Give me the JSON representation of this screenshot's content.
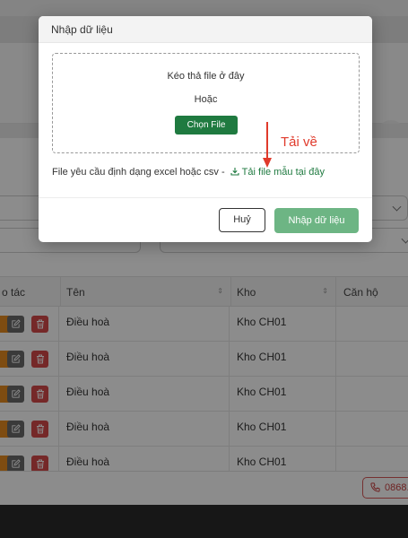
{
  "modal": {
    "title": "Nhập dữ liệu",
    "dropzone_text": "Kéo thả file ở đây",
    "or_text": "Hoặc",
    "choose_button": "Chọn File",
    "requirement_text": "File yêu cầu định dạng excel hoặc csv -",
    "download_link": "Tải file mẫu tại đây",
    "cancel_button": "Huỷ",
    "import_button": "Nhập dữ liệu"
  },
  "annotation": {
    "text": "Tải về",
    "color": "#e03a2b"
  },
  "table": {
    "columns": [
      "o tác",
      "Tên",
      "Kho",
      "Căn hộ"
    ],
    "rows": [
      {
        "name": "Điều hoà",
        "warehouse": "Kho CH01",
        "apartment": ""
      },
      {
        "name": "Điều hoà",
        "warehouse": "Kho CH01",
        "apartment": ""
      },
      {
        "name": "Điều hoà",
        "warehouse": "Kho CH01",
        "apartment": ""
      },
      {
        "name": "Điều hoà",
        "warehouse": "Kho CH01",
        "apartment": ""
      },
      {
        "name": "Điều hoà",
        "warehouse": "Kho CH01",
        "apartment": ""
      }
    ]
  },
  "footer": {
    "phone_label": "0868."
  },
  "colors": {
    "primary_green": "#1f7a40",
    "disabled_green": "#6db584",
    "action_edit": "#6b6b6b",
    "action_delete": "#d64a4a",
    "action_view": "#e58a1f"
  }
}
